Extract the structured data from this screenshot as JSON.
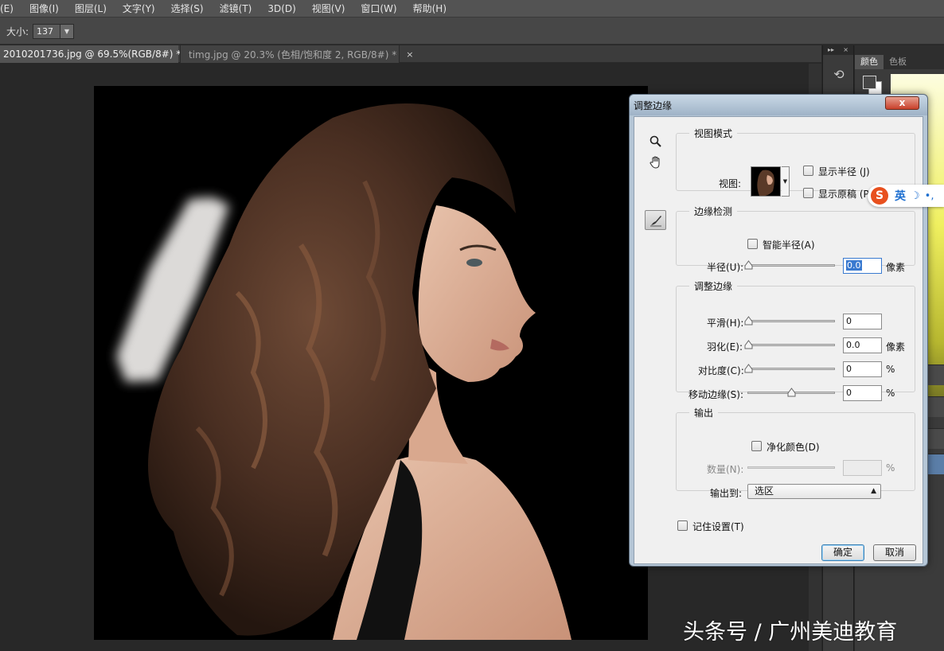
{
  "menubar": {
    "items": [
      {
        "label": "(E)"
      },
      {
        "label": "图像(I)"
      },
      {
        "label": "图层(L)"
      },
      {
        "label": "文字(Y)"
      },
      {
        "label": "选择(S)"
      },
      {
        "label": "滤镜(T)"
      },
      {
        "label": "3D(D)"
      },
      {
        "label": "视图(V)"
      },
      {
        "label": "窗口(W)"
      },
      {
        "label": "帮助(H)"
      }
    ]
  },
  "options_bar": {
    "size_label": "大小:",
    "size_value": "137"
  },
  "documents": [
    {
      "label": "2010201736.jpg @ 69.5%(RGB/8#) *",
      "close": "×"
    },
    {
      "label": "timg.jpg @ 20.3% (色相/饱和度 2, RGB/8#) *",
      "close": "×"
    }
  ],
  "panel": {
    "tabs": [
      "颜色",
      "色板"
    ],
    "foreground_color": "#464646",
    "background_color": "#ffffff",
    "icon_strip_head": [
      "▸▸",
      "×"
    ]
  },
  "dialog": {
    "title": "调整边缘",
    "close": "x",
    "view_mode": {
      "legend": "视图模式",
      "view_label": "视图:",
      "show_radius": "显示半径 (J)",
      "show_original": "显示原稿 (P)"
    },
    "edge_detection": {
      "legend": "边缘检测",
      "smart_radius": "智能半径(A)",
      "radius_label": "半径(U):",
      "radius_value": "0.0",
      "radius_unit": "像素"
    },
    "adjust_edge": {
      "legend": "调整边缘",
      "rows": [
        {
          "label": "平滑(H):",
          "value": "0",
          "unit": ""
        },
        {
          "label": "羽化(E):",
          "value": "0.0",
          "unit": "像素"
        },
        {
          "label": "对比度(C):",
          "value": "0",
          "unit": "%"
        },
        {
          "label": "移动边缘(S):",
          "value": "0",
          "unit": "%"
        }
      ]
    },
    "output": {
      "legend": "输出",
      "decontaminate": "净化颜色(D)",
      "amount_label": "数量(N):",
      "amount_unit": "%",
      "output_to_label": "输出到:",
      "output_to_value": "选区"
    },
    "remember": "记住设置(T)",
    "ok_label": "确定",
    "cancel_label": "取消"
  },
  "ime": {
    "logo": "S",
    "mode": "英",
    "moon": "☽",
    "dot": "•,"
  },
  "watermark": "头条号 / 广州美迪教育"
}
